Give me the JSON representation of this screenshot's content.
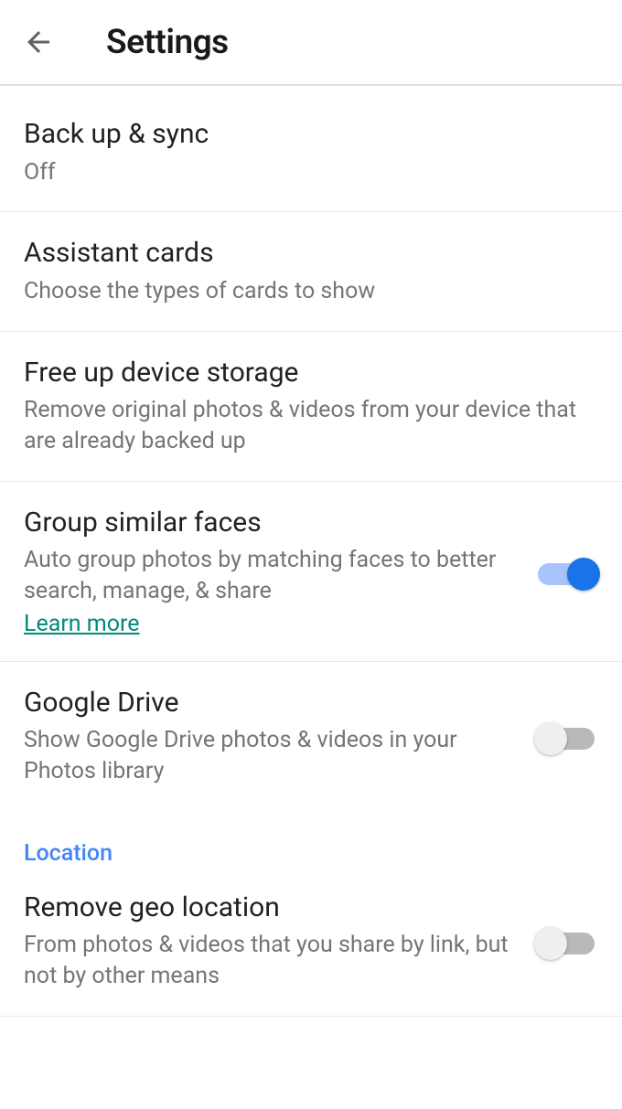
{
  "header": {
    "title": "Settings"
  },
  "items": {
    "backup": {
      "title": "Back up & sync",
      "subtitle": "Off"
    },
    "assistant": {
      "title": "Assistant cards",
      "subtitle": "Choose the types of cards to show"
    },
    "freeup": {
      "title": "Free up device storage",
      "subtitle": "Remove original photos & videos from your device that are already backed up"
    },
    "faces": {
      "title": "Group similar faces",
      "subtitle": "Auto group photos by matching faces to better search, manage, & share",
      "learn_more": "Learn more",
      "enabled": true
    },
    "drive": {
      "title": "Google Drive",
      "subtitle": "Show Google Drive photos & videos in your Photos library",
      "enabled": false
    },
    "geo": {
      "title": "Remove geo location",
      "subtitle": "From photos & videos that you share by link, but not by other means",
      "enabled": false
    }
  },
  "sections": {
    "location": "Location"
  }
}
